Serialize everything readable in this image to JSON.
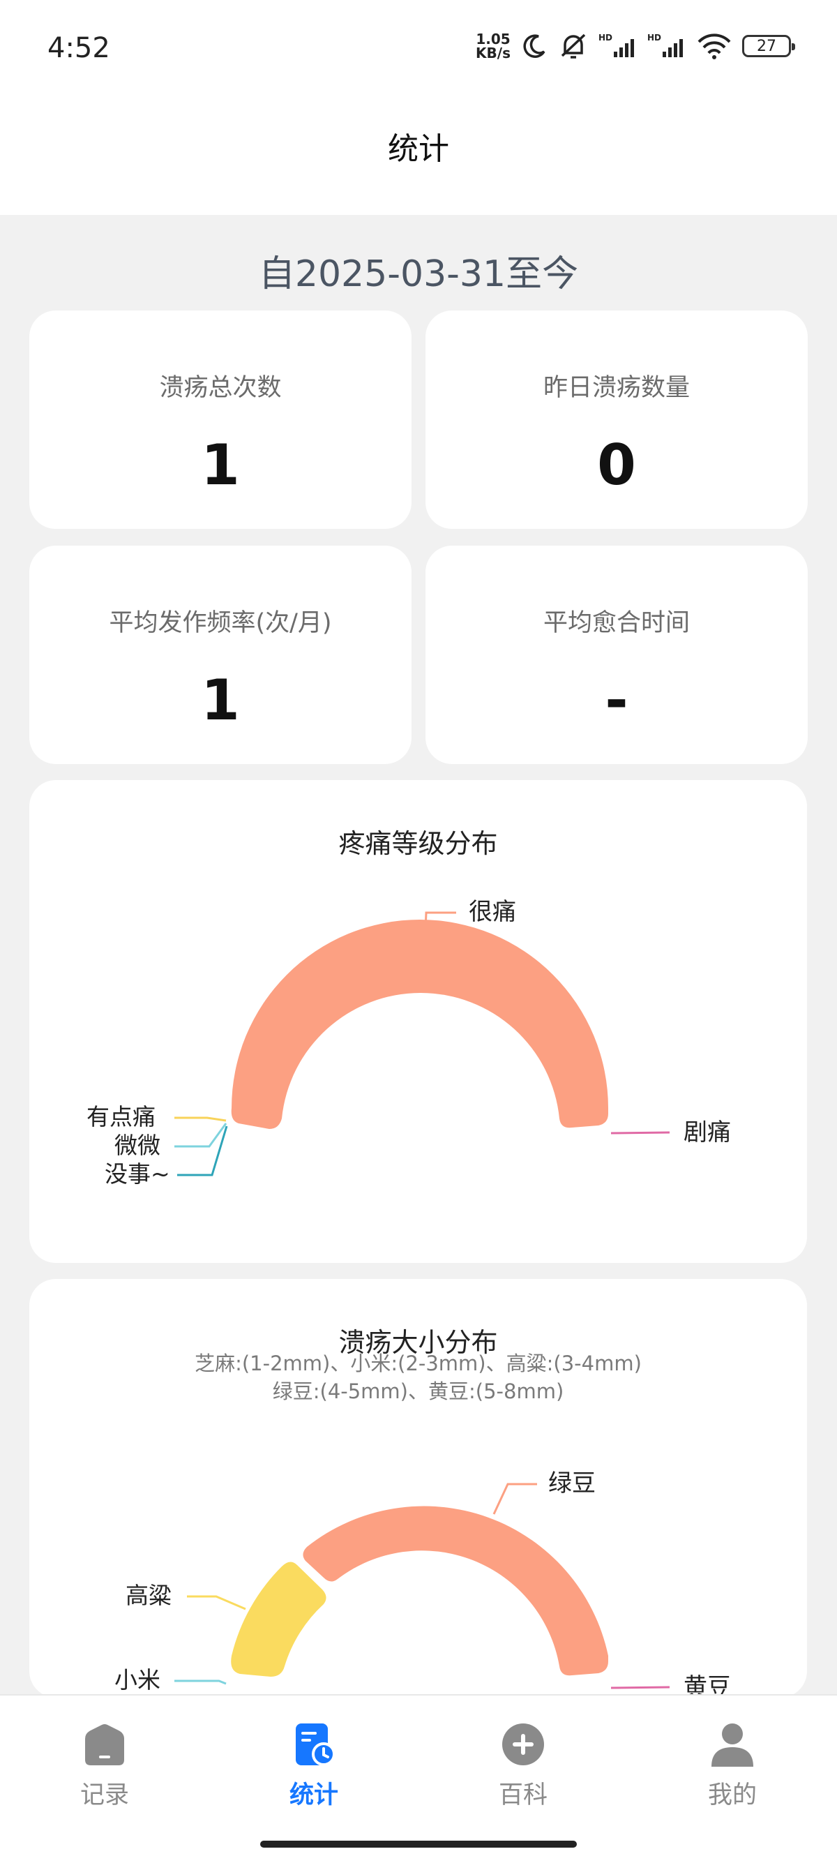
{
  "status_bar": {
    "time": "4:52",
    "net_speed_value": "1.05",
    "net_speed_unit": "KB/s",
    "battery": "27"
  },
  "header": {
    "title": "统计"
  },
  "date_range": "自2025-03-31至今",
  "stats": [
    {
      "label": "溃疡总次数",
      "value": "1"
    },
    {
      "label": "昨日溃疡数量",
      "value": "0"
    },
    {
      "label": "平均发作频率(次/月)",
      "value": "1"
    },
    {
      "label": "平均愈合时间",
      "value": "-"
    }
  ],
  "chart_data": [
    {
      "type": "pie",
      "title": "疼痛等级分布",
      "categories": [
        "没事~",
        "微微",
        "有点痛",
        "很痛",
        "剧痛"
      ],
      "values": [
        0,
        0,
        0,
        1,
        0
      ],
      "colors": [
        "#2ea4b8",
        "#7ed3de",
        "#f8d35a",
        "#fca082",
        "#e06aa5"
      ]
    },
    {
      "type": "pie",
      "title": "溃疡大小分布",
      "subtitle_line1": "芝麻:(1-2mm)、小米:(2-3mm)、高粱:(3-4mm)",
      "subtitle_line2": "绿豆:(4-5mm)、黄豆:(5-8mm)",
      "categories": [
        "小米",
        "高粱",
        "绿豆",
        "黄豆"
      ],
      "values": [
        0,
        1,
        3,
        0
      ],
      "colors": [
        "#7ed3de",
        "#fadb5f",
        "#fca082",
        "#e06aa5"
      ]
    }
  ],
  "nav": [
    {
      "label": "记录",
      "icon": "home-icon"
    },
    {
      "label": "统计",
      "icon": "stats-icon",
      "active": true
    },
    {
      "label": "百科",
      "icon": "plus-circle-icon"
    },
    {
      "label": "我的",
      "icon": "user-icon"
    }
  ]
}
